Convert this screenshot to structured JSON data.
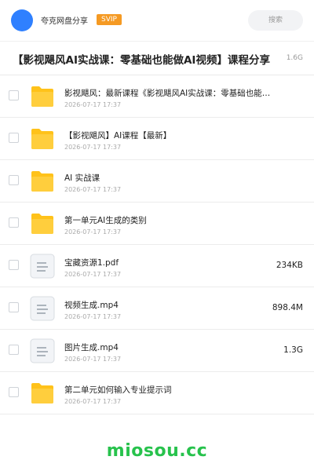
{
  "header": {
    "user_name": "夸克网盘分享",
    "vip_badge": "SVIP",
    "search_placeholder": "搜索"
  },
  "share": {
    "title": "【影视飓风AI实战课：零基础也能做AI视频】课程分享",
    "total_size": "1.6G"
  },
  "files": [
    {
      "type": "folder",
      "name": "影视飓风：最新课程《影视飓风AI实战课：零基础也能做AI视频》",
      "date": "2026-07-17 17:37",
      "size": ""
    },
    {
      "type": "folder",
      "name": "【影视飓风】AI课程【最新】",
      "date": "2026-07-17 17:37",
      "size": ""
    },
    {
      "type": "folder",
      "name": "AI 实战课",
      "date": "2026-07-17 17:37",
      "size": ""
    },
    {
      "type": "folder",
      "name": "第一单元AI生成的类别",
      "date": "2026-07-17 17:37",
      "size": ""
    },
    {
      "type": "file",
      "name": "宝藏资源1.pdf",
      "date": "2026-07-17 17:37",
      "size": "234KB"
    },
    {
      "type": "file",
      "name": "视频生成.mp4",
      "date": "2026-07-17 17:37",
      "size": "898.4M"
    },
    {
      "type": "file",
      "name": "图片生成.mp4",
      "date": "2026-07-17 17:37",
      "size": "1.3G"
    },
    {
      "type": "folder",
      "name": "第二单元如何输入专业提示词",
      "date": "2026-07-17 17:37",
      "size": ""
    }
  ],
  "footer": {
    "watermark": "miosou.cc"
  },
  "colors": {
    "accent_blue": "#2f80ff",
    "vip_orange": "#f59a23",
    "folder_yellow": "#ffc21a",
    "watermark_green": "#27c24c"
  }
}
